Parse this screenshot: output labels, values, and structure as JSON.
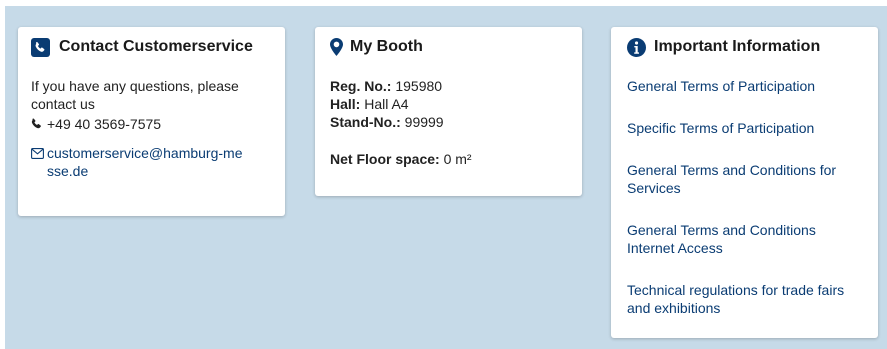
{
  "contact": {
    "title": "Contact Customerservice",
    "text": "If you have any questions, please contact us",
    "phone": "+49 40 3569-7575",
    "email": "customerservice@hamburg-messe.de",
    "icon": "phone-square-icon"
  },
  "booth": {
    "title": "My Booth",
    "reg_label": "Reg. No.:",
    "reg_value": "195980",
    "hall_label": "Hall:",
    "hall_value": "Hall A4",
    "stand_label": "Stand-No.:",
    "stand_value": "99999",
    "floor_label": "Net Floor space:",
    "floor_value": "0 m²",
    "icon": "map-marker-icon"
  },
  "info": {
    "title": "Important Information",
    "icon": "info-circle-icon",
    "links": [
      "General Terms of Participation",
      "Specific Terms of Participation",
      "General Terms and Conditions for Services",
      "General Terms and Conditions Internet Access",
      "Technical regulations for trade fairs and exhibitions"
    ]
  },
  "colors": {
    "background": "#c6dae8",
    "accent": "#0a3c73",
    "card": "#ffffff"
  }
}
